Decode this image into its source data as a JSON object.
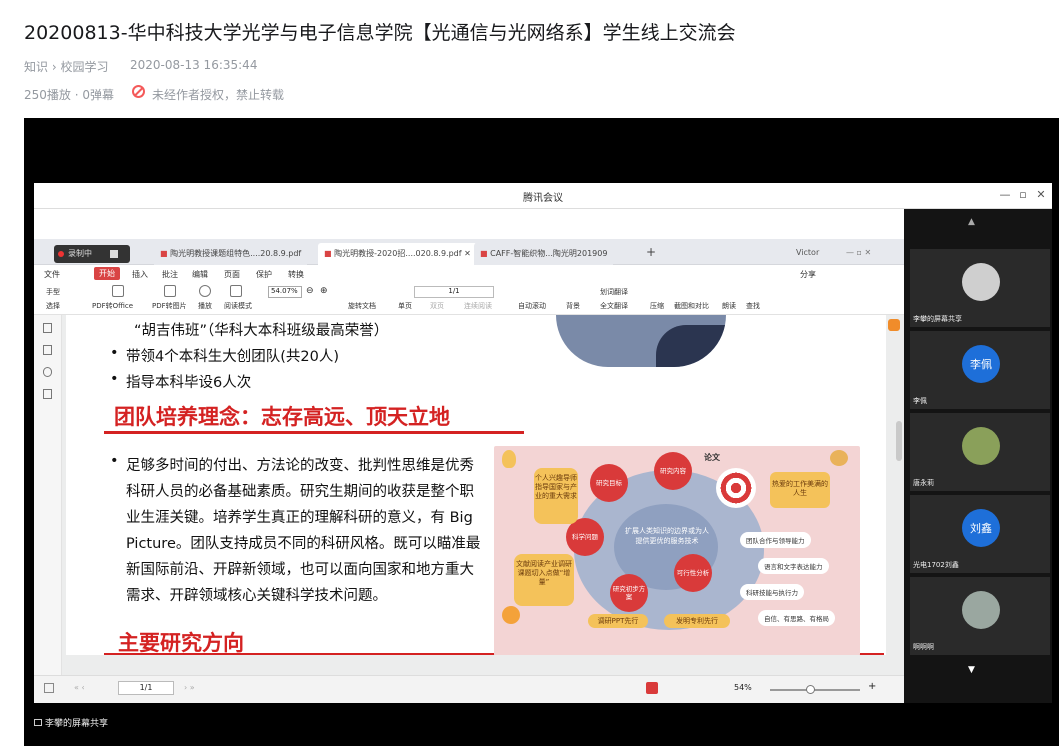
{
  "page": {
    "title": "20200813-华中科技大学光学与电子信息学院【光通信与光网络系】学生线上交流会",
    "breadcrumb": [
      "知识",
      "校园学习"
    ],
    "breadcrumb_sep": "›",
    "date": "2020-08-13 16:35:44",
    "stats": "250播放 · 0弹幕",
    "copyright": "未经作者授权，禁止转载"
  },
  "meeting": {
    "title": "腾讯会议",
    "recording": "录制中",
    "share_label": "李攀的屏幕共享",
    "participants": [
      {
        "avatar": "",
        "name": "李攀的屏幕共享",
        "color": "#cfcfcf"
      },
      {
        "avatar": "李佩",
        "name": "李佩",
        "color": "#1e6fd9"
      },
      {
        "avatar": "",
        "name": "唐永莉",
        "color": "#8aa05a"
      },
      {
        "avatar": "刘鑫",
        "name": "光电1702刘鑫",
        "color": "#1e6fd9"
      },
      {
        "avatar": "",
        "name": "啊啊啊",
        "color": "#9aa7a0"
      }
    ]
  },
  "wps": {
    "tabs": [
      "陶光明教授课题组特色....20.8.9.pdf",
      "陶光明教授-2020招....020.8.9.pdf",
      "CAFF-智能织物...陶光明201909"
    ],
    "user": "Victor",
    "menu": [
      "文件",
      "开始",
      "插入",
      "批注",
      "编辑",
      "页面",
      "保护",
      "转换"
    ],
    "share": "分享",
    "tools": [
      "手型",
      "选择",
      "PDF转Office",
      "PDF转图片",
      "播放",
      "阅读模式",
      "旋转文档",
      "单页",
      "双页",
      "连续阅读",
      "自动滚动",
      "背景",
      "划词翻译",
      "全文翻译",
      "压缩",
      "截图和对比",
      "朗读",
      "查找"
    ],
    "zoom": "54.07%",
    "page": "1/1",
    "status_page": "1/1",
    "status_zoom": "54%"
  },
  "slide": {
    "top_line": "“胡吉伟班”（华科大本科班级最高荣誉）",
    "bullets_top": [
      "带领4个本科生大创团队(共20人)",
      "指导本科毕设6人次"
    ],
    "heading1": "团队培养理念：志存高远、顶天立地",
    "paragraph": "足够多时间的付出、方法论的改变、批判性思维是优秀科研人员的必备基础素质。研究生期间的收获是整个职业生涯关键。培养学生真正的理解科研的意义，有 Big Picture。团队支持成员不同的科研风格。既可以瞄准最新国际前沿、开辟新领域，也可以面向国家和地方重大需求、开辟领域核心关键科学技术问题。",
    "heading2": "主要研究方向",
    "infographic": {
      "circles": [
        "研究目标",
        "研究内容",
        "科学问题",
        "研究初步方案",
        "可行性分析"
      ],
      "center": "扩展人类知识的边界或为人提供更优的服务技术",
      "thesis": "论文",
      "left_top": "个人兴趣导师指导国家与产业的重大需求",
      "left_bottom": "文献阅读产业调研课题切入点做“增量”",
      "right_top": "热爱的工作美满的人生",
      "pills": [
        "团队合作与领导能力",
        "语言和文字表达能力",
        "科研技能与执行力",
        "自信、有思路、有格局"
      ],
      "bottom": [
        "调研PPT先行",
        "发明专利先行"
      ]
    }
  }
}
